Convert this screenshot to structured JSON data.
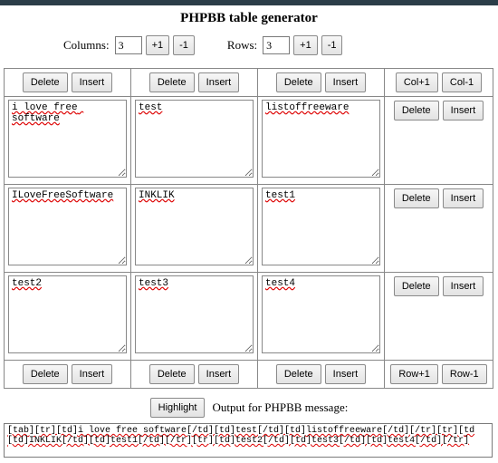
{
  "title": "PHPBB table generator",
  "dims": {
    "columns_label": "Columns:",
    "columns_value": "3",
    "rows_label": "Rows:",
    "rows_value": "3",
    "plus1": "+1",
    "minus1": "-1"
  },
  "labels": {
    "delete": "Delete",
    "insert": "Insert",
    "col_plus": "Col+1",
    "col_minus": "Col-1",
    "row_plus": "Row+1",
    "row_minus": "Row-1",
    "highlight": "Highlight",
    "output_label": "Output for PHPBB message:"
  },
  "cells": {
    "r0": [
      "i love free software",
      "test",
      "listoffreeware"
    ],
    "r1": [
      "ILoveFreeSoftware",
      "INKLIK",
      "test1"
    ],
    "r2": [
      "test2",
      "test3",
      "test4"
    ]
  },
  "output": "[tab][tr][td]i love free software[/td][td]test[/td][td]listoffreeware[/td][/tr][tr][td\n[td]INKLIK[/td][td]test1[/td][/tr][tr][td]test2[/td][td]test3[/td][td]test4[/td][/tr]"
}
